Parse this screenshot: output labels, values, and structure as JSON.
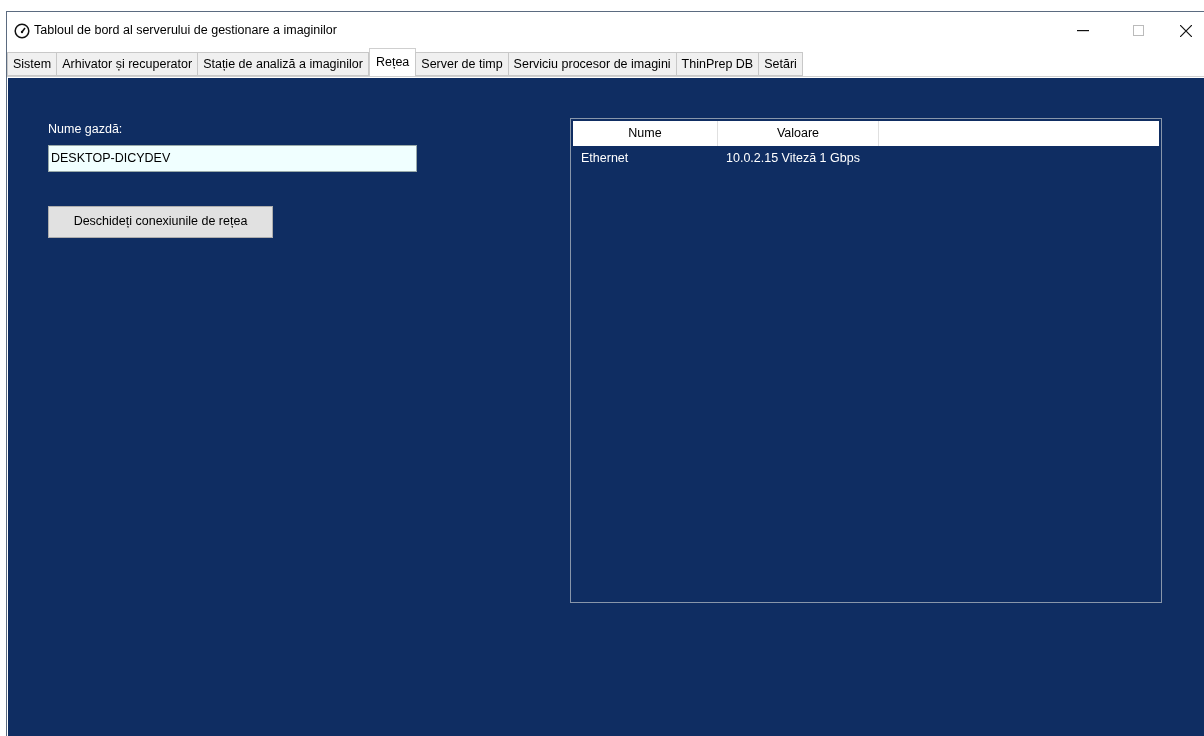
{
  "window": {
    "title": "Tabloul de bord al serverului de gestionare a imaginilor"
  },
  "tabs": [
    {
      "label": "Sistem",
      "selected": false
    },
    {
      "label": "Arhivator și recuperator",
      "selected": false
    },
    {
      "label": "Stație de analiză a imaginilor",
      "selected": false
    },
    {
      "label": "Rețea",
      "selected": true
    },
    {
      "label": "Server de timp",
      "selected": false
    },
    {
      "label": "Serviciu procesor de imagini",
      "selected": false
    },
    {
      "label": "ThinPrep DB",
      "selected": false
    },
    {
      "label": "Setări",
      "selected": false
    }
  ],
  "hostname": {
    "label": "Nume gazdă:",
    "value": "DESKTOP-DICYDEV"
  },
  "open_button": {
    "label": "Deschideți conexiunile de rețea"
  },
  "table": {
    "columns": [
      "Nume",
      "Valoare"
    ],
    "rows": [
      [
        "Ethernet",
        "10.0.2.15 Viteză 1 Gbps"
      ]
    ]
  }
}
